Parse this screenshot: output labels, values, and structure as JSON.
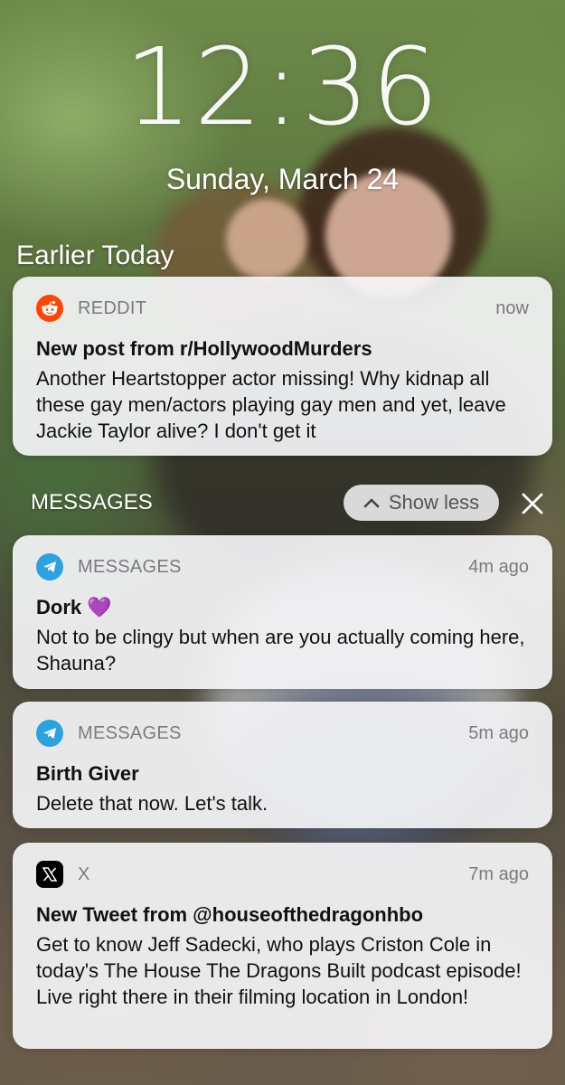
{
  "lockscreen": {
    "time": "12:36",
    "date": "Sunday, March 24"
  },
  "section": {
    "title": "Earlier Today"
  },
  "group": {
    "label": "MESSAGES",
    "show_less_label": "Show less"
  },
  "notifications": [
    {
      "app": "REDDIT",
      "icon": "reddit-icon",
      "time": "now",
      "title": "New post from r/HollywoodMurders",
      "body": "Another Heartstopper actor missing! Why kidnap all these gay men/actors playing gay men and yet, leave Jackie Taylor alive? I don't get it"
    },
    {
      "app": "MESSAGES",
      "icon": "telegram-icon",
      "time": "4m ago",
      "title": "Dork",
      "title_emoji": "💜",
      "body": "Not to be clingy but when are you actually coming here, Shauna?"
    },
    {
      "app": "MESSAGES",
      "icon": "telegram-icon",
      "time": "5m ago",
      "title": "Birth Giver",
      "body": "Delete that now. Let's talk."
    },
    {
      "app": "X",
      "icon": "x-logo-icon",
      "time": "7m ago",
      "title": "New Tweet from @houseofthedragonhbo",
      "body": "Get to know Jeff Sadecki, who plays Criston Cole in today's The House The Dragons Built podcast episode! Live right there in their filming location in London!"
    }
  ],
  "colors": {
    "reddit": "#ff4500",
    "telegram": "#2aa3e0",
    "x": "#000000",
    "heart": "#9b3fe0"
  }
}
